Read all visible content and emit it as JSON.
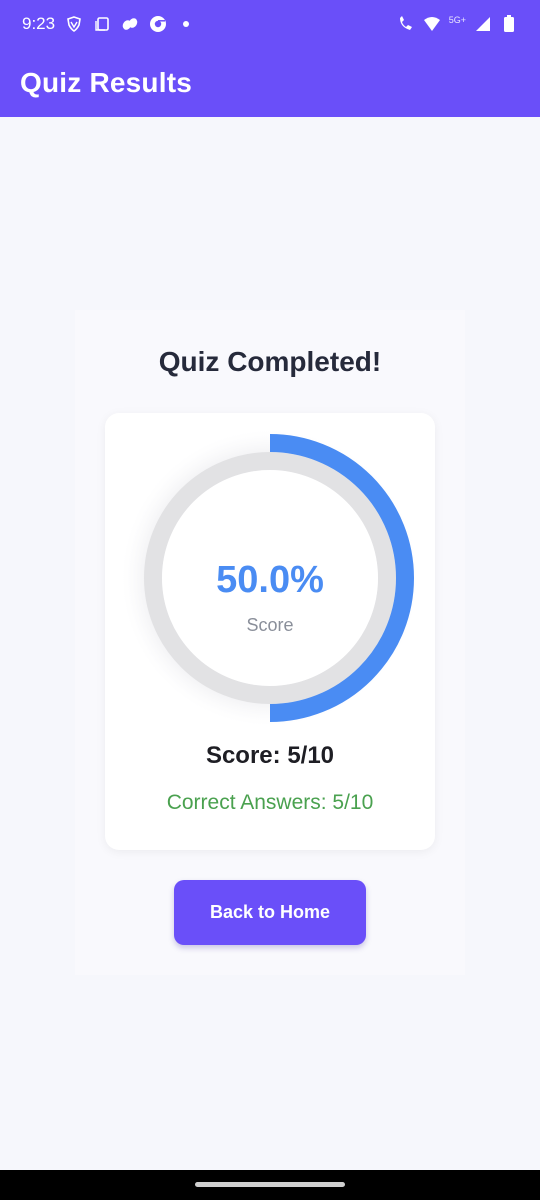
{
  "status_bar": {
    "time": "9:23",
    "network_label": "5G+",
    "left_icons": [
      "shield-icon",
      "copy-icon",
      "cloud-icon",
      "chrome-icon",
      "dot-icon"
    ],
    "right_icons": [
      "wifi-call-icon",
      "wifi-icon",
      "signal-icon",
      "battery-icon"
    ]
  },
  "app_bar": {
    "title": "Quiz Results",
    "color": "#6a4ff9"
  },
  "result": {
    "heading": "Quiz Completed!",
    "percent_text": "50.0%",
    "percent_value": 0.5,
    "score_caption": "Score",
    "score_line": "Score: 5/10",
    "correct_line": "Correct Answers: 5/10",
    "progress_color": "#4a8cf3",
    "correct_color": "#4aa14f"
  },
  "actions": {
    "back_label": "Back to Home"
  }
}
